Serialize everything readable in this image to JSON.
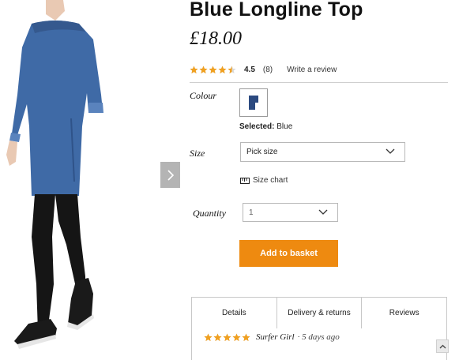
{
  "product": {
    "title": "Blue Longline Top",
    "price": "£18.00",
    "rating_value": "4.5",
    "rating_count": "(8)",
    "rating_stars": 4.5,
    "write_review": "Write a review"
  },
  "options": {
    "colour_label": "Colour",
    "selected_key": "Selected:",
    "selected_value": "Blue",
    "swatch_color": "#2c4a80",
    "size_label": "Size",
    "size_value": "Pick size",
    "size_chart": "Size chart",
    "quantity_label": "Quantity",
    "quantity_value": "1"
  },
  "actions": {
    "add_to_basket": "Add to basket"
  },
  "tabs": [
    {
      "label": "Details"
    },
    {
      "label": "Delivery & returns"
    },
    {
      "label": "Reviews"
    }
  ],
  "review": {
    "stars": 5,
    "author": "Surfer Girl",
    "date": "· 5 days ago"
  },
  "colors": {
    "accent": "#ee8a10",
    "star": "#f0a020",
    "dress": "#3f6aa6"
  }
}
